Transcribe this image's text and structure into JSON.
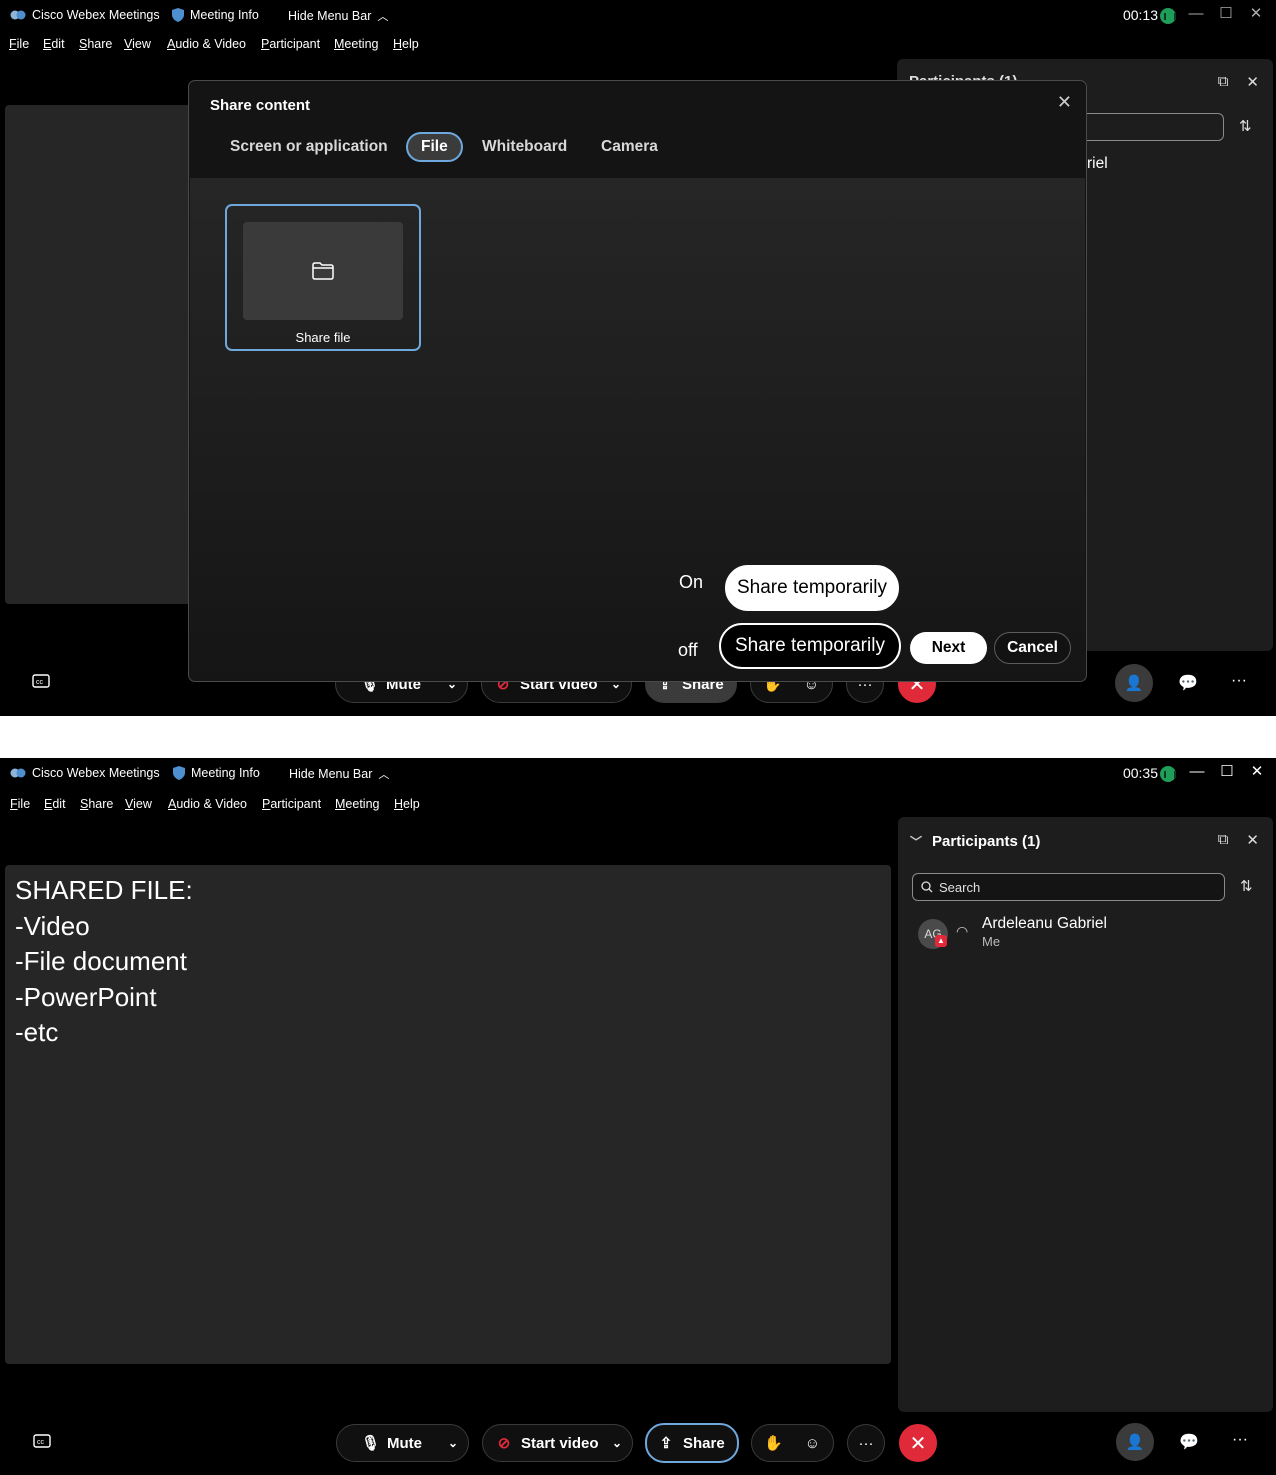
{
  "window1": {
    "title": "Cisco Webex Meetings",
    "meeting_info": "Meeting Info",
    "hide_menu_bar": "Hide Menu Bar",
    "timer": "00:13",
    "menu": [
      "File",
      "Edit",
      "Share",
      "View",
      "Audio & Video",
      "Participant",
      "Meeting",
      "Help"
    ],
    "participants_header_partial": "Participants (1)",
    "participant_name_partial": "riel",
    "dialog": {
      "title": "Share content",
      "tabs": [
        {
          "label": "Screen or application",
          "active": false
        },
        {
          "label": "File",
          "active": true
        },
        {
          "label": "Whiteboard",
          "active": false
        },
        {
          "label": "Camera",
          "active": false
        }
      ],
      "card_label": "Share file",
      "toggle_on_label": "On",
      "toggle_off_label": "off",
      "share_temp_on": "Share temporarily",
      "share_temp_off": "Share temporarily",
      "next": "Next",
      "cancel": "Cancel"
    },
    "toolbar": {
      "mute": "Mute",
      "start_video": "Start video",
      "share": "Share"
    }
  },
  "window2": {
    "title": "Cisco Webex Meetings",
    "meeting_info": "Meeting Info",
    "hide_menu_bar": "Hide Menu Bar",
    "timer": "00:35",
    "menu": [
      "File",
      "Edit",
      "Share",
      "View",
      "Audio & Video",
      "Participant",
      "Meeting",
      "Help"
    ],
    "shared_content": [
      "SHARED FILE:",
      "-Video",
      "-File document",
      "-PowerPoint",
      "-etc"
    ],
    "participants": {
      "header": "Participants (1)",
      "search_placeholder": "Search",
      "list": [
        {
          "name": "Ardeleanu Gabriel",
          "sub": "Me",
          "initials": "AG"
        }
      ]
    },
    "toolbar": {
      "mute": "Mute",
      "start_video": "Start video",
      "share": "Share"
    }
  },
  "colors": {
    "accent": "#6fa8dc",
    "end_call": "#e02a3a",
    "signal": "#1f9e5a"
  }
}
